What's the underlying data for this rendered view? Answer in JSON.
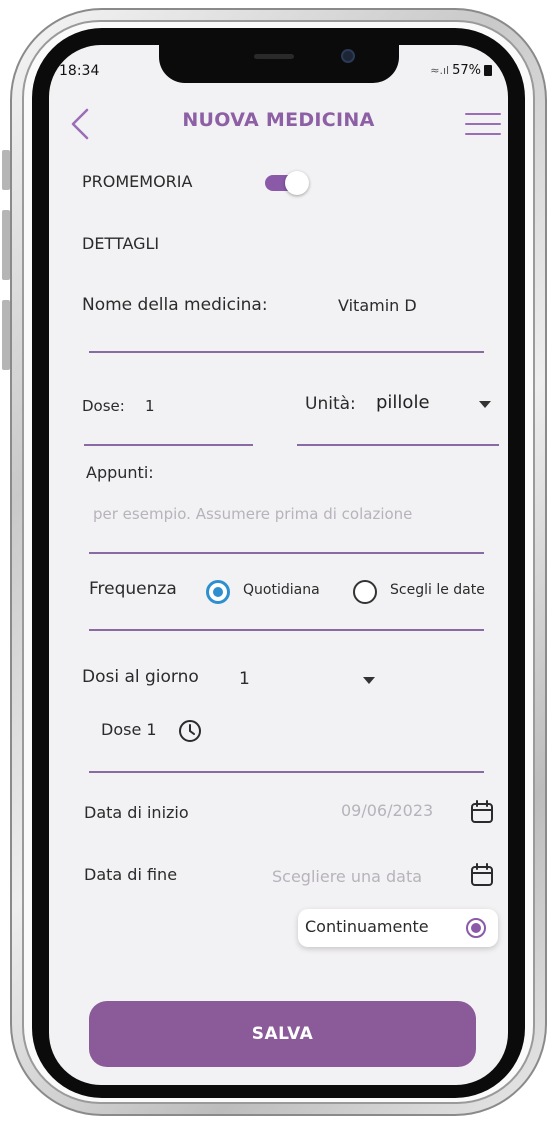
{
  "status_bar": {
    "time": "18:34",
    "battery": "57%"
  },
  "header": {
    "title": "NUOVA MEDICINA"
  },
  "reminder": {
    "label": "PROMEMORIA",
    "enabled": true
  },
  "details": {
    "section_label": "DETTAGLI"
  },
  "medicine_name": {
    "label": "Nome della medicina:",
    "value": "Vitamin D"
  },
  "dose": {
    "label": "Dose:",
    "value": "1"
  },
  "unit": {
    "label": "Unità:",
    "value": "pillole"
  },
  "notes": {
    "label": "Appunti:",
    "placeholder": "per esempio. Assumere prima di colazione"
  },
  "frequency": {
    "label": "Frequenza",
    "options": [
      {
        "label": "Quotidiana",
        "selected": true
      },
      {
        "label": "Scegli le date",
        "selected": false
      }
    ]
  },
  "doses_per_day": {
    "label": "Dosi al giorno",
    "value": "1"
  },
  "dose_times": [
    {
      "label": "Dose 1"
    }
  ],
  "start_date": {
    "label": "Data di inizio",
    "value": "09/06/2023"
  },
  "end_date": {
    "label": "Data di fine",
    "placeholder": "Scegliere una data"
  },
  "continuous": {
    "label": "Continuamente",
    "selected": true
  },
  "actions": {
    "save_label": "SALVA"
  },
  "colors": {
    "accent": "#8a5aa8",
    "title": "#8d5fa5",
    "radio_blue": "#2e8fd0",
    "button": "#8a5a99"
  },
  "icons": [
    "back-arrow-icon",
    "hamburger-menu-icon",
    "clock-icon",
    "calendar-icon",
    "dropdown-caret-icon"
  ]
}
